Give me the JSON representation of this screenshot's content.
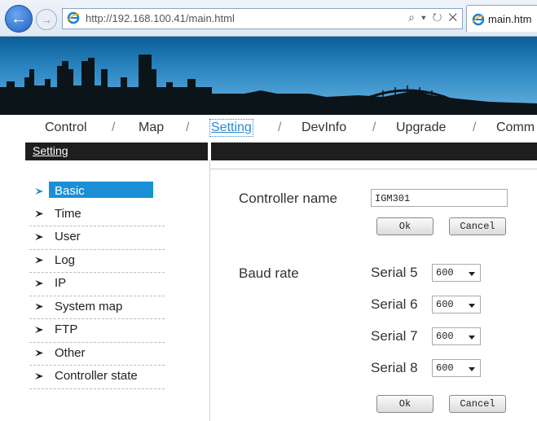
{
  "browser": {
    "url": "http://192.168.100.41/main.html",
    "address_tools": "⌕ ▾ ↻ ✕",
    "tab_title": "main.htm"
  },
  "menu": {
    "items": [
      "Control",
      "Map",
      "Setting",
      "DevInfo",
      "Upgrade",
      "Comm"
    ],
    "separator": "/",
    "active": "Setting"
  },
  "section_header": "Setting",
  "sidebar": {
    "items": [
      "Basic",
      "Time",
      "User",
      "Log",
      "IP",
      "System map",
      "FTP",
      "Other",
      "Controller state"
    ],
    "active": "Basic"
  },
  "controller": {
    "label": "Controller name",
    "value": "IGM301",
    "ok_label": "Ok",
    "cancel_label": "Cancel"
  },
  "baud": {
    "label": "Baud rate",
    "serials": [
      {
        "label": "Serial 5",
        "value": "600"
      },
      {
        "label": "Serial 6",
        "value": "600"
      },
      {
        "label": "Serial 7",
        "value": "600"
      },
      {
        "label": "Serial 8",
        "value": "600"
      }
    ],
    "ok_label": "Ok",
    "cancel_label": "Cancel"
  },
  "colors": {
    "accent": "#1a8fd6",
    "header_bar": "#1e1e1e"
  }
}
